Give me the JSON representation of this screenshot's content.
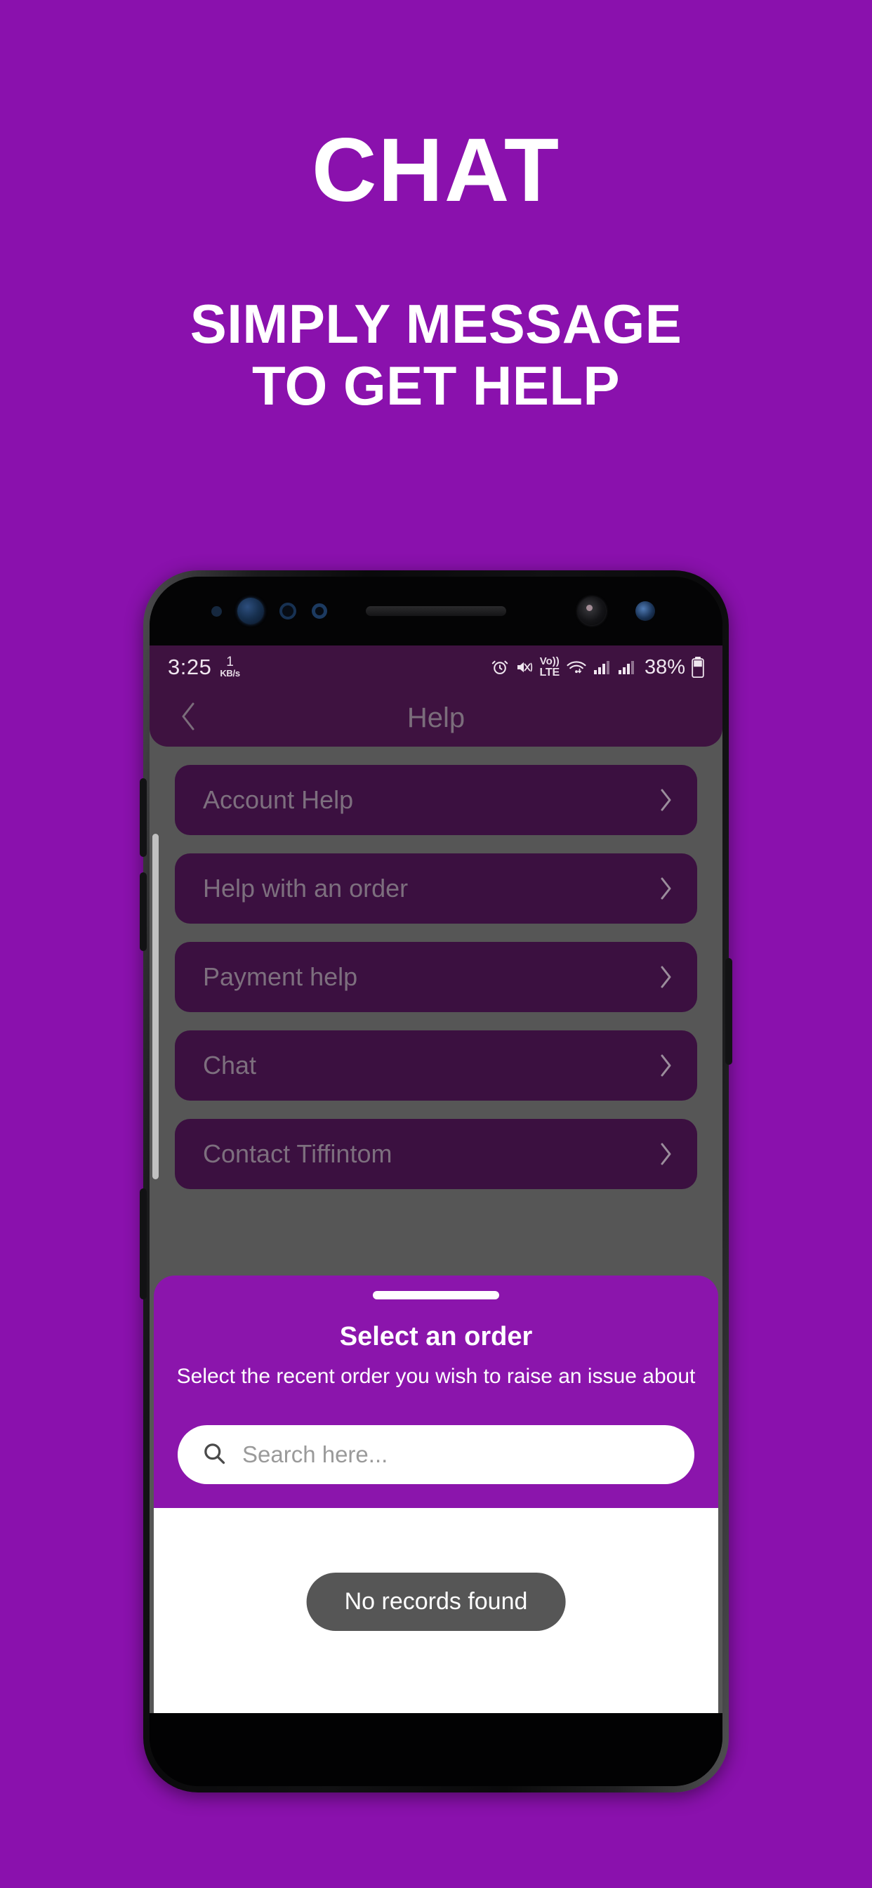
{
  "promo": {
    "title": "CHAT",
    "subtitle_line1": "SIMPLY MESSAGE",
    "subtitle_line2": "TO GET HELP"
  },
  "colors": {
    "brand_purple": "#8A11AD",
    "sheet_purple": "#8B15AC",
    "appbar_purple": "#3E1240",
    "row_purple": "#3B1040",
    "scrim_gray": "#565656",
    "toast_gray": "#565656"
  },
  "statusbar": {
    "time": "3:25",
    "net_speed_value": "1",
    "net_speed_unit": "KB/s",
    "alarm_icon": "alarm-clock-icon",
    "mute_icon": "volume-mute-vibrate-icon",
    "volte_line1": "Vo))",
    "volte_line2": "LTE",
    "wifi_icon": "wifi-icon",
    "signal_icon_1": "cellular-signal-icon",
    "signal_icon_2": "cellular-signal-icon",
    "battery_percent": "38%",
    "battery_icon": "battery-icon"
  },
  "appbar": {
    "back_icon": "chevron-left-icon",
    "title": "Help"
  },
  "help_list": {
    "chevron_icon": "chevron-right-icon",
    "items": [
      {
        "label": "Account Help"
      },
      {
        "label": "Help with an order"
      },
      {
        "label": "Payment help"
      },
      {
        "label": "Chat"
      },
      {
        "label": "Contact Tiffintom"
      }
    ]
  },
  "sheet": {
    "handle": "drag-handle",
    "title": "Select an order",
    "subtitle": "Select the recent order you wish to raise an issue about",
    "search": {
      "icon": "search-icon",
      "value": "",
      "placeholder": "Search here..."
    },
    "empty_state": "No records found"
  },
  "hardware": {
    "earpiece": "earpiece-speaker",
    "front_camera": "front-camera",
    "iris_scanner": "iris-scanner",
    "proximity_sensor": "proximity-sensor",
    "volume_up": "volume-up-button",
    "volume_down": "volume-down-button",
    "bixby": "bixby-button",
    "power": "power-button"
  }
}
